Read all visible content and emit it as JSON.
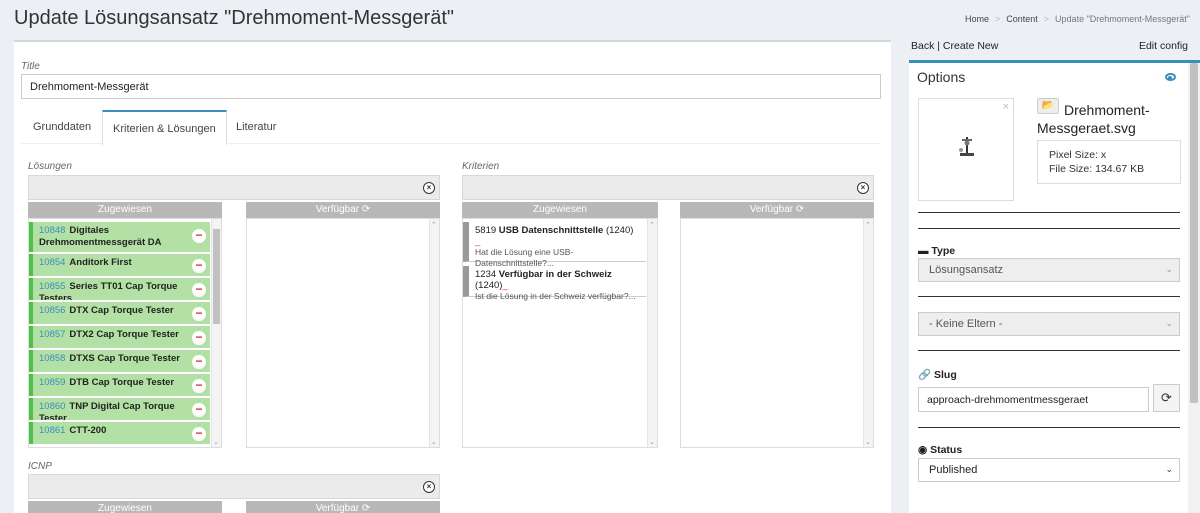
{
  "header": {
    "title": "Update Lösungsansatz \"Drehmoment-Messgerät\"",
    "breadcrumb": [
      "Home",
      "Content",
      "Update \"Drehmoment-Messgerät\""
    ]
  },
  "form": {
    "title_label": "Title",
    "title_value": "Drehmoment-Messgerät",
    "tabs": [
      "Grunddaten",
      "Kriterien & Lösungen",
      "Literatur"
    ],
    "active_tab": "Kriterien & Lösungen"
  },
  "loesungen": {
    "label": "Lösungen",
    "assigned_header": "Zugewiesen",
    "available_header": "Verfügbar",
    "items": [
      {
        "id": "10848",
        "name": "Digitales Drehmomentmessgerät DA"
      },
      {
        "id": "10854",
        "name": "Anditork First"
      },
      {
        "id": "10855",
        "name": "Series TT01 Cap Torque Testers"
      },
      {
        "id": "10856",
        "name": "DTX Cap Torque Tester"
      },
      {
        "id": "10857",
        "name": "DTX2 Cap Torque Tester"
      },
      {
        "id": "10858",
        "name": "DTXS Cap Torque Tester"
      },
      {
        "id": "10859",
        "name": "DTB Cap Torque Tester"
      },
      {
        "id": "10860",
        "name": "TNP Digital Cap Torque Tester"
      },
      {
        "id": "10861",
        "name": "CTT-200"
      }
    ]
  },
  "kriterien": {
    "label": "Kriterien",
    "assigned_header": "Zugewiesen",
    "available_header": "Verfügbar",
    "items": [
      {
        "id": "5819",
        "name": "USB Datenschnittstelle",
        "count": "(1240)",
        "question": "Hat die Lösung eine USB-Datenschnittstelle?..."
      },
      {
        "id": "1234",
        "name": "Verfügbar in der Schweiz",
        "count": "(1240)",
        "question": "Ist die Lösung in der Schweiz verfügbar?..."
      }
    ]
  },
  "icnp": {
    "label": "ICNP",
    "assigned_header": "Zugewiesen",
    "available_header": "Verfügbar"
  },
  "sidebar": {
    "back_create": "Back | Create New",
    "edit_config": "Edit config",
    "options_title": "Options",
    "file_name": "Drehmoment-Messgeraet.svg",
    "pixel_size": "Pixel Size: x",
    "file_size": "File Size: 134.67 KB",
    "type_label": "Type",
    "type_value": "Lösungsansatz",
    "parent_value": "- Keine Eltern -",
    "slug_label": "Slug",
    "slug_value": "approach-drehmomentmessgeraet",
    "status_label": "Status",
    "status_value": "Published"
  },
  "colors": {
    "accent": "#3c8dbc",
    "assigned_item_bg": "#b3e0a5",
    "assigned_item_border": "#4fc04a",
    "remove": "#dd3333"
  }
}
